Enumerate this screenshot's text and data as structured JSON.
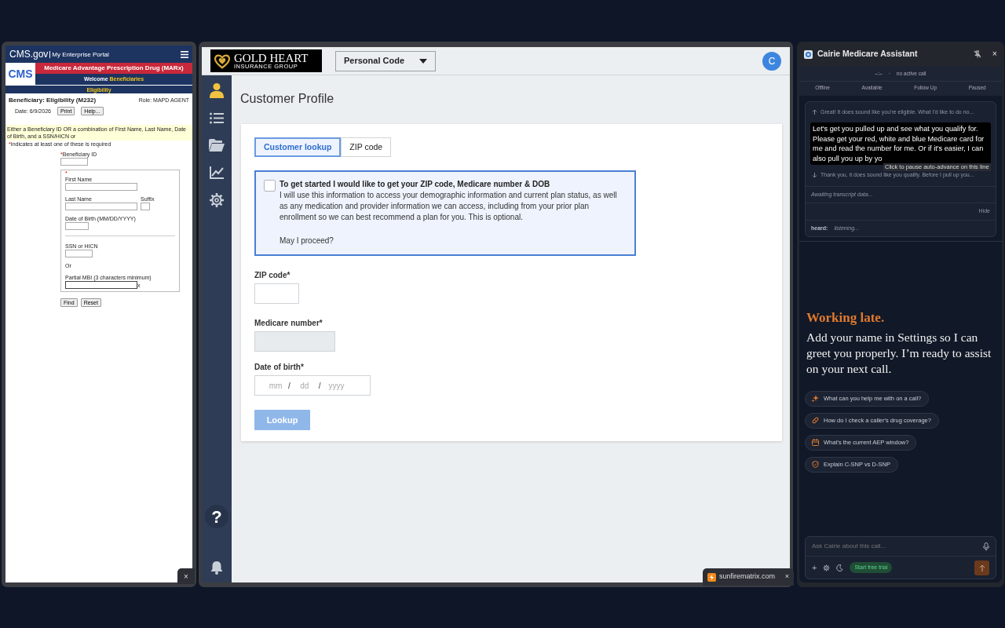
{
  "cms_window": {
    "brand": "CMS.gov",
    "portal": "My Enterprise Portal",
    "logo": "CMS",
    "banner": "Medicare Advantage Prescription Drug (MARx)",
    "welcome": "Welcome",
    "welcome_user": "Beneficiaries",
    "section": "Eligibility",
    "page_title": "Beneficiary: Eligibility (M232)",
    "role_label": "Role:",
    "role": "MAPD AGENT",
    "date_label": "Date:",
    "date": "6/9/2026",
    "buttons": [
      "Print",
      "Help..."
    ],
    "notice": "Either a Beneficiary ID OR a combination of First Name, Last Name, Date of Birth, and a SSN/HICN or",
    "required_mark": "*",
    "required_note": "Indicates at least one of these is required",
    "beneficiary_id": "Beneficiary ID",
    "group_mark": "*",
    "first_name": "First Name",
    "last_name": "Last Name",
    "suffix": "Suffix",
    "dob": "Date of Birth (MM/DD/YYYY)",
    "ssn": "SSN or HICN",
    "or": "Or",
    "mbi": "Partial MBI (3 characters minimum)",
    "mbi_clear": "x",
    "actions": [
      "Find",
      "Reset"
    ],
    "close": "×"
  },
  "app": {
    "logo_title": "GOLD HEART",
    "logo_subtitle": "INSURANCE GROUP",
    "dropdown": "Personal Code",
    "avatar": "C",
    "sidebar": [
      {
        "selected": true
      },
      {
        "selected": false
      },
      {
        "selected": false
      },
      {
        "selected": false
      },
      {
        "selected": false
      }
    ],
    "help": "?",
    "page_title": "Customer Profile",
    "tabs": [
      {
        "label": "Customer lookup",
        "selected": true
      },
      {
        "label": "ZIP code",
        "selected": false
      }
    ],
    "consent": {
      "checked": false,
      "title": "To get started I would like to get your ZIP code, Medicare number & DOB",
      "body": "I will use this information to access your demographic information and current plan status, as well as any medication and provider information we can access, including from your prior plan enrollment so we can best recommend a plan for you. This is optional.",
      "question": "May I proceed?"
    },
    "fields": [
      {
        "kind": "text",
        "label": "ZIP code*"
      },
      {
        "kind": "locked",
        "label": "Medicare number*"
      },
      {
        "kind": "date",
        "label": "Date of birth*",
        "placeholders": [
          "mm",
          "dd",
          "yyyy"
        ],
        "separators": [
          "/",
          "/"
        ]
      }
    ],
    "lookup": {
      "label": "Lookup",
      "disabled": true
    }
  },
  "browser_tab": {
    "title": "sunfirematrix.com",
    "close": "×"
  },
  "assistant": {
    "title": "Cairie Medicare Assistant",
    "close": "×",
    "call_timer": "–:–",
    "separator": "·",
    "call_status": "no active call",
    "statuses": [
      "Offline",
      "Available",
      "Follow Up",
      "Paused"
    ],
    "transcript": {
      "previous": "Great! It does sound like you're eligible. What I'd like to do no...",
      "current": "Let's get you pulled up and see what you qualify for. Please get your red, white and blue Medicare card for me and read the number for me. Or if it's easier, I can also pull you up by yo",
      "tooltip": "Click to pause auto-advance on this line",
      "next": "Thank you, it does sound like you qualify. Before I pull up you...",
      "awaiting": "Awaiting transcript data...",
      "hide": "Hide",
      "heard_label": "heard:",
      "heard": "listening..."
    },
    "greeting_title": "Working late.",
    "greeting": "Add your name in Settings so I can greet you properly. I’m ready to assist on your next call.",
    "suggestions": [
      {
        "label": "What can you help me with on a call?"
      },
      {
        "label": "How do I check a caller's drug coverage?"
      },
      {
        "label": "What's the current AEP window?"
      },
      {
        "label": "Explain C-SNP vs D-SNP"
      }
    ],
    "input_placeholder": "Ask Cairie about this call...",
    "add": "+",
    "trial": "Start free trial"
  }
}
